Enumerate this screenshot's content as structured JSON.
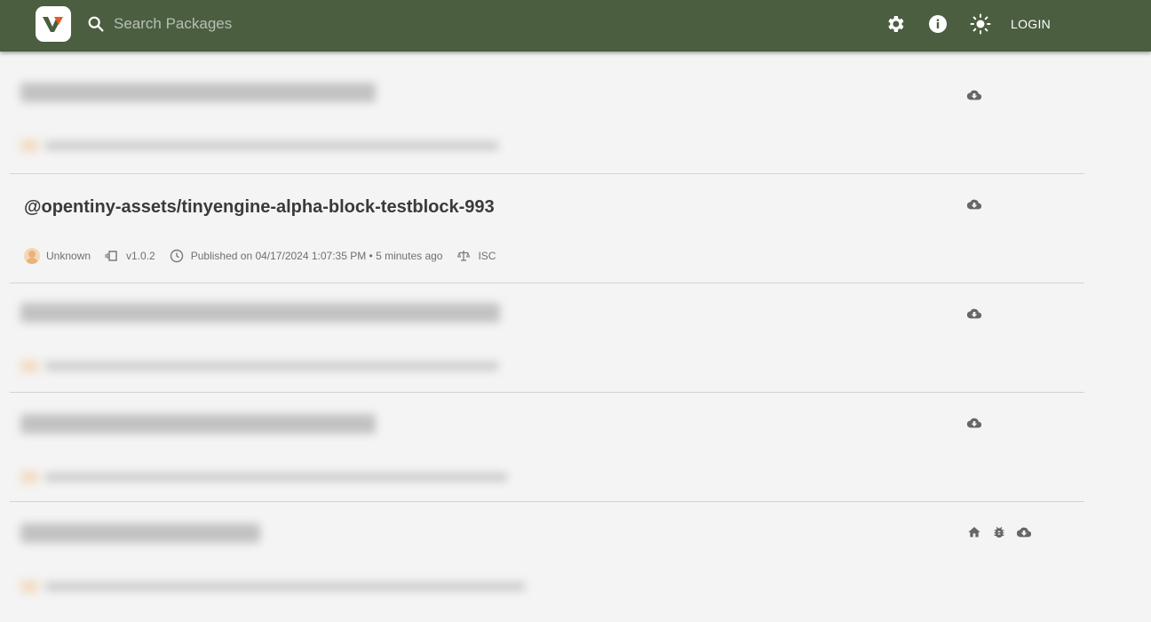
{
  "header": {
    "search_placeholder": "Search Packages",
    "login_label": "LOGIN",
    "icons": [
      "settings-icon",
      "info-icon",
      "brightness-icon"
    ],
    "brand_color": "#4b5e40",
    "logo_color": "#e8582a"
  },
  "packages": [
    {
      "name": "@opentiny-assets/tinyengine-alpha-block-testblock-993",
      "author": "Unknown",
      "version": "v1.0.2",
      "published": "Published on 04/17/2024 1:07:35 PM • 5 minutes ago",
      "license": "ISC"
    }
  ]
}
